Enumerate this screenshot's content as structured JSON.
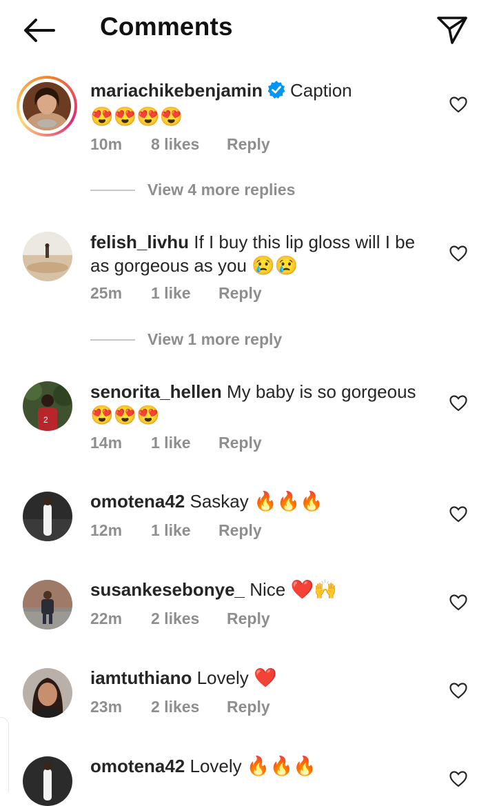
{
  "header": {
    "title": "Comments"
  },
  "comments": [
    {
      "user": "mariachikebenjamin",
      "verified": true,
      "text": "Caption",
      "emoji": "😍😍😍😍",
      "time": "10m",
      "likes": "8 likes",
      "reply": "Reply"
    },
    {
      "user": "felish_livhu",
      "text": "If I buy this lip gloss will I be as gorgeous as you",
      "emoji": "😢😢",
      "time": "25m",
      "likes": "1 like",
      "reply": "Reply"
    },
    {
      "user": "senorita_hellen",
      "text": "My baby is so gorgeous",
      "emoji": "😍😍😍",
      "time": "14m",
      "likes": "1 like",
      "reply": "Reply"
    },
    {
      "user": "omotena42",
      "text": "Saskay",
      "emoji": "🔥🔥🔥",
      "time": "12m",
      "likes": "1 like",
      "reply": "Reply"
    },
    {
      "user": "susankesebonye_",
      "text": "Nice",
      "emoji": "❤️🙌",
      "time": "22m",
      "likes": "2 likes",
      "reply": "Reply"
    },
    {
      "user": "iamtuthiano",
      "text": "Lovely",
      "emoji": "❤️",
      "time": "23m",
      "likes": "2 likes",
      "reply": "Reply"
    },
    {
      "user": "omotena42",
      "text": "Lovely",
      "emoji": "🔥🔥🔥",
      "time": "",
      "likes": "",
      "reply": ""
    }
  ],
  "view_more": [
    "View 4 more replies",
    "View 1 more reply"
  ],
  "colors": {
    "text": "#262626",
    "muted": "#8e8e8e",
    "verified": "#0095f6"
  },
  "icons": {
    "back": "arrow-left-icon",
    "share": "send-icon",
    "like": "heart-icon",
    "verified": "verified-badge-icon"
  }
}
